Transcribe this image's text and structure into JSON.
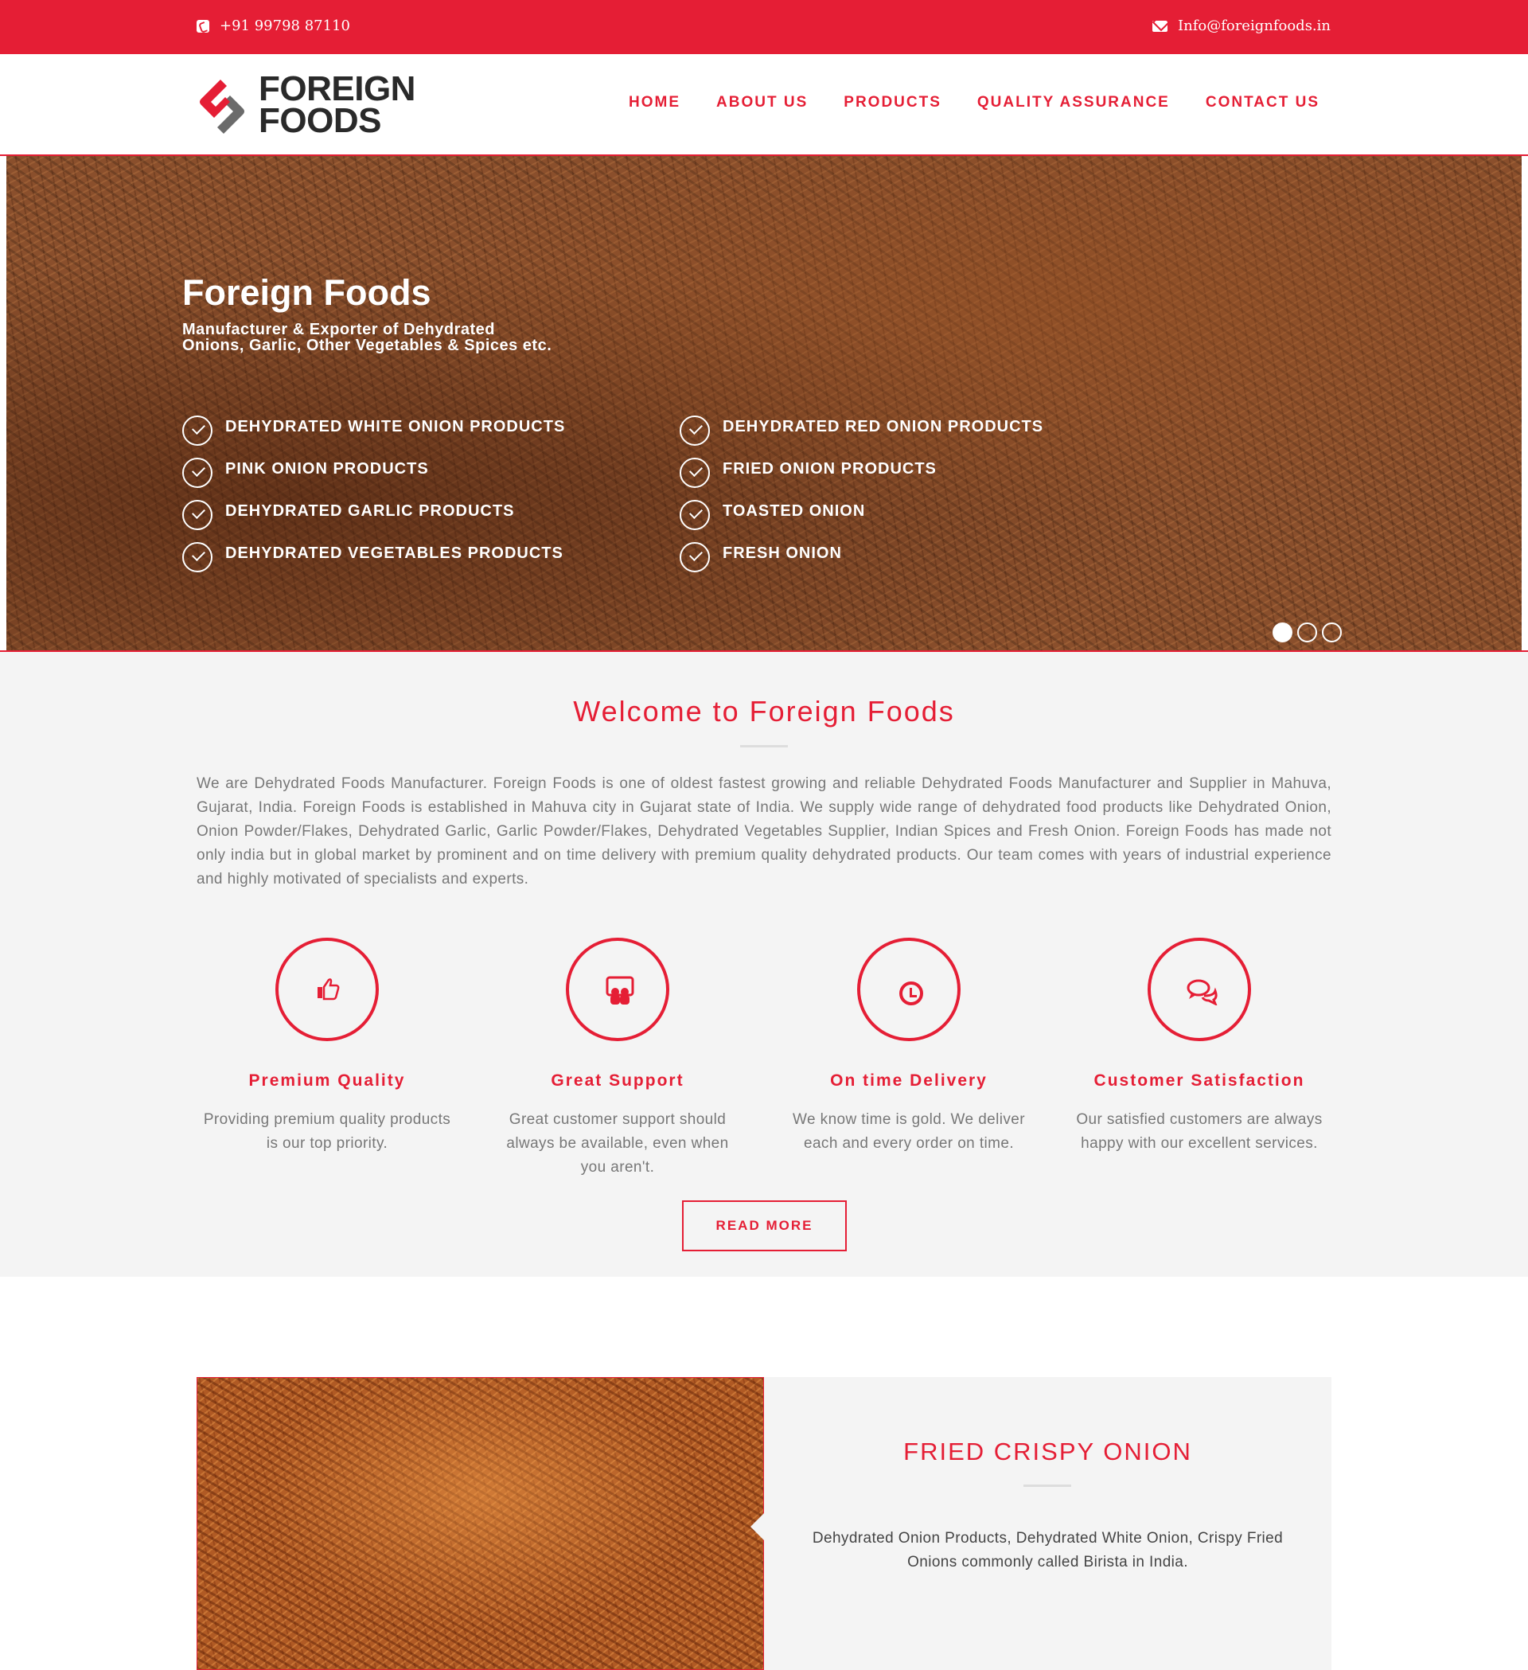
{
  "topbar": {
    "phone": "+91 99798 87110",
    "email": "Info@foreignfoods.in"
  },
  "brand": {
    "logo_line1": "FOREIGN",
    "logo_line2": "FOODS",
    "accent_color": "#e51e35"
  },
  "nav": {
    "items": [
      {
        "label": "HOME"
      },
      {
        "label": "ABOUT US"
      },
      {
        "label": "PRODUCTS"
      },
      {
        "label": "QUALITY ASSURANCE"
      },
      {
        "label": "CONTACT US"
      }
    ]
  },
  "hero": {
    "title": "Foreign Foods",
    "subtitle": "Manufacturer & Exporter of Dehydrated Onions, Garlic, Other Vegetables & Spices etc.",
    "left_list": [
      {
        "label": "DEHYDRATED WHITE ONION PRODUCTS"
      },
      {
        "label": "PINK ONION PRODUCTS"
      },
      {
        "label": "DEHYDRATED GARLIC PRODUCTS"
      },
      {
        "label": "DEHYDRATED VEGETABLES PRODUCTS"
      }
    ],
    "right_list": [
      {
        "label": "DEHYDRATED RED ONION PRODUCTS"
      },
      {
        "label": "FRIED ONION PRODUCTS"
      },
      {
        "label": "TOASTED ONION"
      },
      {
        "label": "FRESH ONION"
      }
    ],
    "slide_count": 3,
    "active_slide": 1
  },
  "welcome": {
    "heading": "Welcome to Foreign Foods",
    "intro": "We are Dehydrated Foods Manufacturer. Foreign Foods is one of oldest fastest growing and reliable Dehydrated Foods Manufacturer and Supplier in Mahuva, Gujarat, India. Foreign Foods is established in Mahuva city in Gujarat state of India. We supply wide range of dehydrated food products like Dehydrated Onion, Onion Powder/Flakes, Dehydrated Garlic, Garlic Powder/Flakes, Dehydrated Vegetables Supplier, Indian Spices and Fresh Onion. Foreign Foods has made not only india but in global market by prominent and on time delivery with premium quality dehydrated products. Our team comes with years of industrial experience and highly motivated of specialists and experts.",
    "features": [
      {
        "icon": "thumbs-up-icon",
        "title": "Premium Quality",
        "desc": "Providing premium quality products is our top priority."
      },
      {
        "icon": "support-icon",
        "title": "Great Support",
        "desc": "Great customer support should always be available, even when you aren't."
      },
      {
        "icon": "clock-icon",
        "title": "On time Delivery",
        "desc": "We know time is gold. We deliver each and every order on time."
      },
      {
        "icon": "chat-icon",
        "title": "Customer Satisfaction",
        "desc": "Our satisfied customers are always happy with our excellent services."
      }
    ],
    "button_label": "READ MORE"
  },
  "product": {
    "title": "FRIED CRISPY ONION",
    "desc": "Dehydrated Onion Products, Dehydrated White Onion, Crispy Fried Onions commonly called Birista in India."
  }
}
